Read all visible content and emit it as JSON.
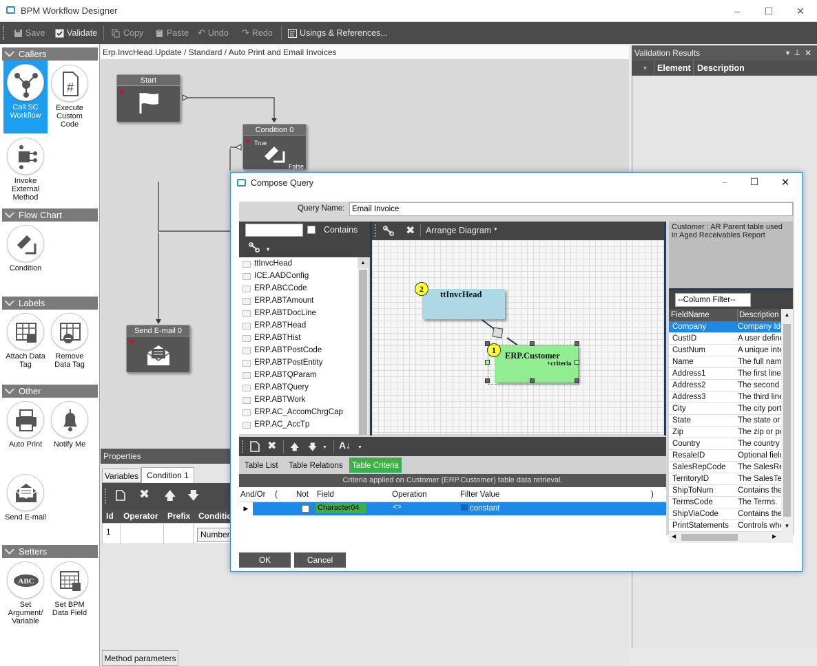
{
  "window": {
    "title": "BPM Workflow Designer"
  },
  "toolbar": {
    "save": "Save",
    "validate": "Validate",
    "copy": "Copy",
    "paste": "Paste",
    "undo": "Undo",
    "redo": "Redo",
    "usings": "Usings & References..."
  },
  "sidebar": {
    "groups": {
      "callers": "Callers",
      "flowchart": "Flow Chart",
      "labels": "Labels",
      "other": "Other",
      "setters": "Setters"
    },
    "tools": {
      "call_sc": "Call SC Workflow",
      "execute": "Execute Custom Code",
      "invoke": "Invoke External Method",
      "condition": "Condition",
      "attach": "Attach Data Tag",
      "remove": "Remove Data Tag",
      "auto_print": "Auto Print",
      "notify": "Notify Me",
      "send_email": "Send E-mail",
      "set_arg": "Set Argument/ Variable",
      "set_bpm": "Set BPM Data Field"
    }
  },
  "canvas": {
    "title": "Erp.InvcHead.Update / Standard / Auto Print and Email Invoices",
    "nodes": {
      "start": "Start",
      "condition": "Condition 0",
      "true": "True",
      "false": "False",
      "send": "Send E-mail 0"
    }
  },
  "validation": {
    "title": "Validation Results",
    "col_element": "Element",
    "col_description": "Description"
  },
  "properties": {
    "title": "Properties",
    "tabs": [
      "Variables",
      "Condition 1"
    ],
    "cols": [
      "Id",
      "Operator",
      "Prefix",
      "Condition"
    ],
    "row": {
      "id": "1",
      "value": "Number"
    },
    "bottom_tab": "Method parameters"
  },
  "dialog": {
    "title": "Compose Query",
    "query_name_label": "Query Name:",
    "query_name": "Email Invoice",
    "contains": "Contains",
    "arrange": "Arrange Diagram",
    "tables": [
      "ttInvcHead",
      "ICE.AADConfig",
      "ERP.ABCCode",
      "ERP.ABTAmount",
      "ERP.ABTDocLine",
      "ERP.ABTHead",
      "ERP.ABTHist",
      "ERP.ABTPostCode",
      "ERP.ABTPostEntity",
      "ERP.ABTQParam",
      "ERP.ABTQuery",
      "ERP.ABTWork",
      "ERP.AC_AccomChrgCap",
      "ERP.AC_AccTp"
    ],
    "diagram": {
      "t1_num": "2",
      "t1_name": "ttInvcHead",
      "t2_num": "1",
      "t2_name": "ERP.Customer",
      "t2_sub": "+criteria"
    },
    "tabs": [
      "Table List",
      "Table Relations",
      "Table Criteria"
    ],
    "criteria_caption": "Criteria applied on Customer (ERP.Customer)  table data retrieval.",
    "criteria_cols": [
      "And/Or",
      "(",
      "Not",
      "Field",
      "Operation",
      "Filter Value",
      ")"
    ],
    "criteria_row": {
      "field": "Character04",
      "operation": "<>",
      "filter": "constant"
    },
    "desc": "Customer : AR Parent table used in Aged Receivables Report",
    "column_filter": "--Column Filter--",
    "field_cols": [
      "FieldName",
      "Description"
    ],
    "fields": [
      [
        "Company",
        "Company Identifier"
      ],
      [
        "CustID",
        "A user defined"
      ],
      [
        "CustNum",
        "A unique integer"
      ],
      [
        "Name",
        "The full name"
      ],
      [
        "Address1",
        "The first line"
      ],
      [
        "Address2",
        "The second line"
      ],
      [
        "Address3",
        "The third line"
      ],
      [
        "City",
        "The city portion"
      ],
      [
        "State",
        "The state or province"
      ],
      [
        "Zip",
        "The zip or postal"
      ],
      [
        "Country",
        "The country"
      ],
      [
        "ResaleID",
        "Optional field"
      ],
      [
        "SalesRepCode",
        "The SalesRep"
      ],
      [
        "TerritoryID",
        "The SalesTerritory"
      ],
      [
        "ShipToNum",
        "Contains the"
      ],
      [
        "TermsCode",
        "The Terms."
      ],
      [
        "ShipViaCode",
        "Contains the"
      ],
      [
        "PrintStatements",
        "Controls whether"
      ]
    ],
    "ok": "OK",
    "cancel": "Cancel"
  },
  "colors": {
    "accent": "#1e9ef0",
    "criteria_row": "#1e88e5",
    "customer_fill": "#90ee90",
    "invchead_fill": "#add8e6"
  }
}
